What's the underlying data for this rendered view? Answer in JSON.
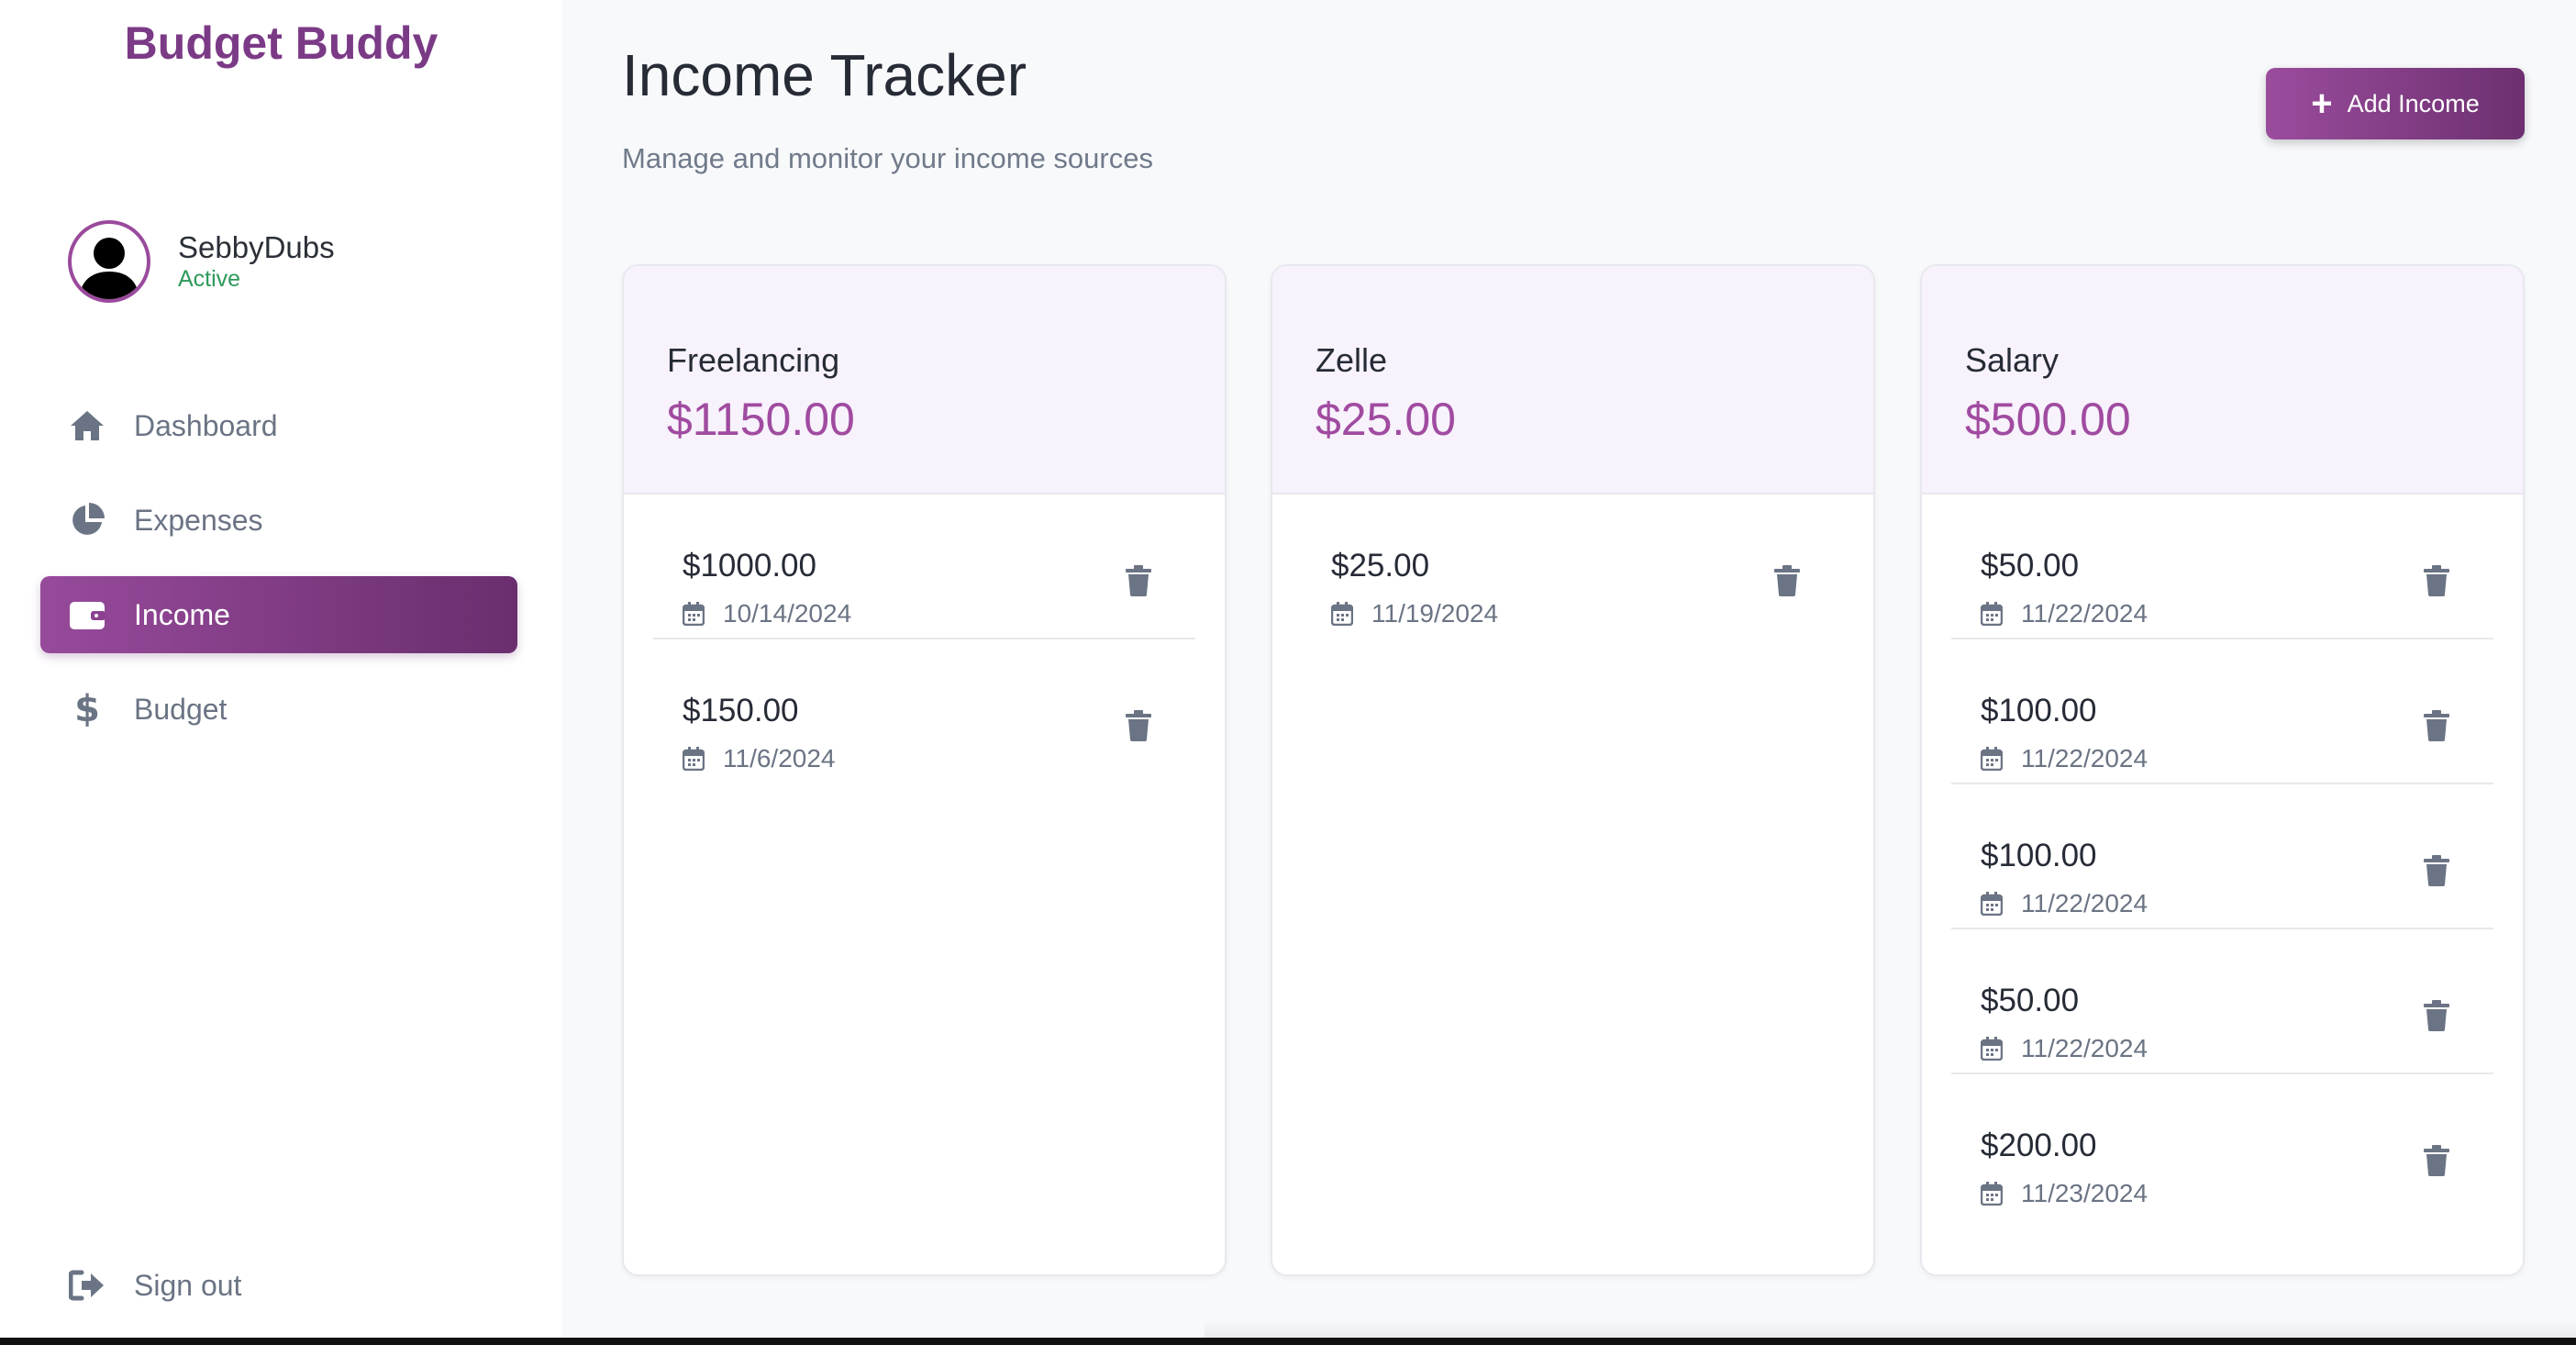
{
  "sidebar": {
    "brand": "Budget Buddy",
    "user": {
      "name": "SebbyDubs",
      "status": "Active",
      "avatar_icon": "user-avatar-icon"
    },
    "nav": [
      {
        "label": "Dashboard",
        "icon": "home-icon",
        "active": false
      },
      {
        "label": "Expenses",
        "icon": "pie-chart-icon",
        "active": false
      },
      {
        "label": "Income",
        "icon": "wallet-icon",
        "active": true
      },
      {
        "label": "Budget",
        "icon": "dollar-icon",
        "active": false
      }
    ],
    "signout": {
      "label": "Sign out",
      "icon": "sign-out-icon"
    }
  },
  "header": {
    "title": "Income Tracker",
    "subtitle": "Manage and monitor your income sources",
    "add_button": "Add Income"
  },
  "cards": [
    {
      "name": "Freelancing",
      "total": "$1150.00",
      "entries": [
        {
          "amount": "$1000.00",
          "date": "10/14/2024"
        },
        {
          "amount": "$150.00",
          "date": "11/6/2024"
        }
      ]
    },
    {
      "name": "Zelle",
      "total": "$25.00",
      "entries": [
        {
          "amount": "$25.00",
          "date": "11/19/2024"
        }
      ]
    },
    {
      "name": "Salary",
      "total": "$500.00",
      "entries": [
        {
          "amount": "$50.00",
          "date": "11/22/2024"
        },
        {
          "amount": "$100.00",
          "date": "11/22/2024"
        },
        {
          "amount": "$100.00",
          "date": "11/22/2024"
        },
        {
          "amount": "$50.00",
          "date": "11/22/2024"
        },
        {
          "amount": "$200.00",
          "date": "11/23/2024"
        }
      ]
    }
  ],
  "colors": {
    "brand": "#7b3a86",
    "accent": "#9a4c9d",
    "total_text": "#a04ba0",
    "status_active": "#2e9a5b"
  }
}
